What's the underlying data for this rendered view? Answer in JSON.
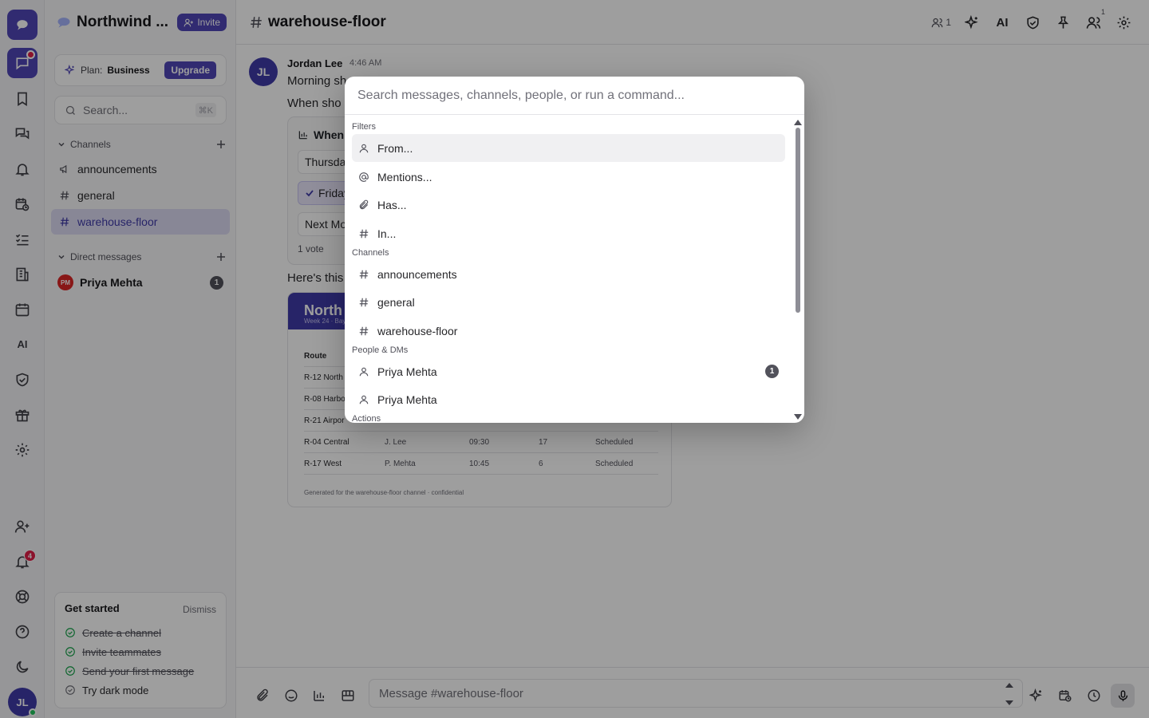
{
  "app": {
    "workspace_name": "Northwind ...",
    "invite_label": "Invite",
    "plan_label": "Plan:",
    "plan_name": "Business",
    "upgrade_label": "Upgrade",
    "search_placeholder": "Search...",
    "search_shortcut": "⌘K"
  },
  "rail": {
    "ai_label": "AI",
    "notifications_count": "4",
    "user_initials": "JL"
  },
  "sidebar": {
    "channels_header": "Channels",
    "channels": [
      {
        "name": "announcements",
        "icon": "megaphone-icon"
      },
      {
        "name": "general",
        "icon": "hash-icon"
      },
      {
        "name": "warehouse-floor",
        "icon": "hash-icon",
        "active": true
      }
    ],
    "dm_header": "Direct messages",
    "dms": [
      {
        "initials": "PM",
        "name": "Priya Mehta",
        "unread": "1"
      }
    ],
    "get_started": {
      "title": "Get started",
      "dismiss": "Dismiss",
      "items": [
        {
          "label": "Create a channel",
          "done": true
        },
        {
          "label": "Invite teammates",
          "done": true
        },
        {
          "label": "Send your first message",
          "done": true
        },
        {
          "label": "Try dark mode",
          "done": false
        }
      ]
    }
  },
  "header": {
    "channel_title": "warehouse-floor",
    "members_count": "1",
    "ai_label": "AI",
    "people_badge": "1"
  },
  "message": {
    "initials": "JL",
    "author": "Jordan Lee",
    "time": "4:46 AM",
    "line1": "Morning sh",
    "line2": "When sho",
    "poll": {
      "title": "When",
      "options": [
        {
          "label": "Thursda",
          "selected": false
        },
        {
          "label": "Friday",
          "selected": true
        },
        {
          "label": "Next Mo",
          "selected": false
        }
      ],
      "votes": "1 vote"
    },
    "line3": "Here's this",
    "sheet": {
      "title": "North",
      "subtitle": "Week 24 · Bay",
      "header": [
        "Route",
        "",
        "",
        "",
        ""
      ],
      "rows": [
        [
          "R-12 North",
          "",
          "",
          "",
          ""
        ],
        [
          "R-08 Harbo",
          "",
          "",
          "",
          ""
        ],
        [
          "R-21 Airpor",
          "",
          "",
          "",
          ""
        ],
        [
          "R-04 Central",
          "J. Lee",
          "09:30",
          "17",
          "Scheduled"
        ],
        [
          "R-17 West",
          "P. Mehta",
          "10:45",
          "6",
          "Scheduled"
        ]
      ],
      "footer": "Generated for the warehouse-floor channel · confidential"
    }
  },
  "composer": {
    "placeholder": "Message #warehouse-floor"
  },
  "palette": {
    "placeholder": "Search messages, channels, people, or run a command...",
    "groups": {
      "filters": "Filters",
      "channels": "Channels",
      "people": "People & DMs",
      "actions": "Actions"
    },
    "filters": [
      {
        "label": "From...",
        "icon": "person-icon"
      },
      {
        "label": "Mentions...",
        "icon": "at-icon"
      },
      {
        "label": "Has...",
        "icon": "paperclip-icon"
      },
      {
        "label": "In...",
        "icon": "hash-icon"
      }
    ],
    "channels": [
      "announcements",
      "general",
      "warehouse-floor"
    ],
    "people": [
      {
        "label": "Priya Mehta",
        "badge": "1"
      },
      {
        "label": "Priya Mehta",
        "badge": ""
      }
    ]
  }
}
